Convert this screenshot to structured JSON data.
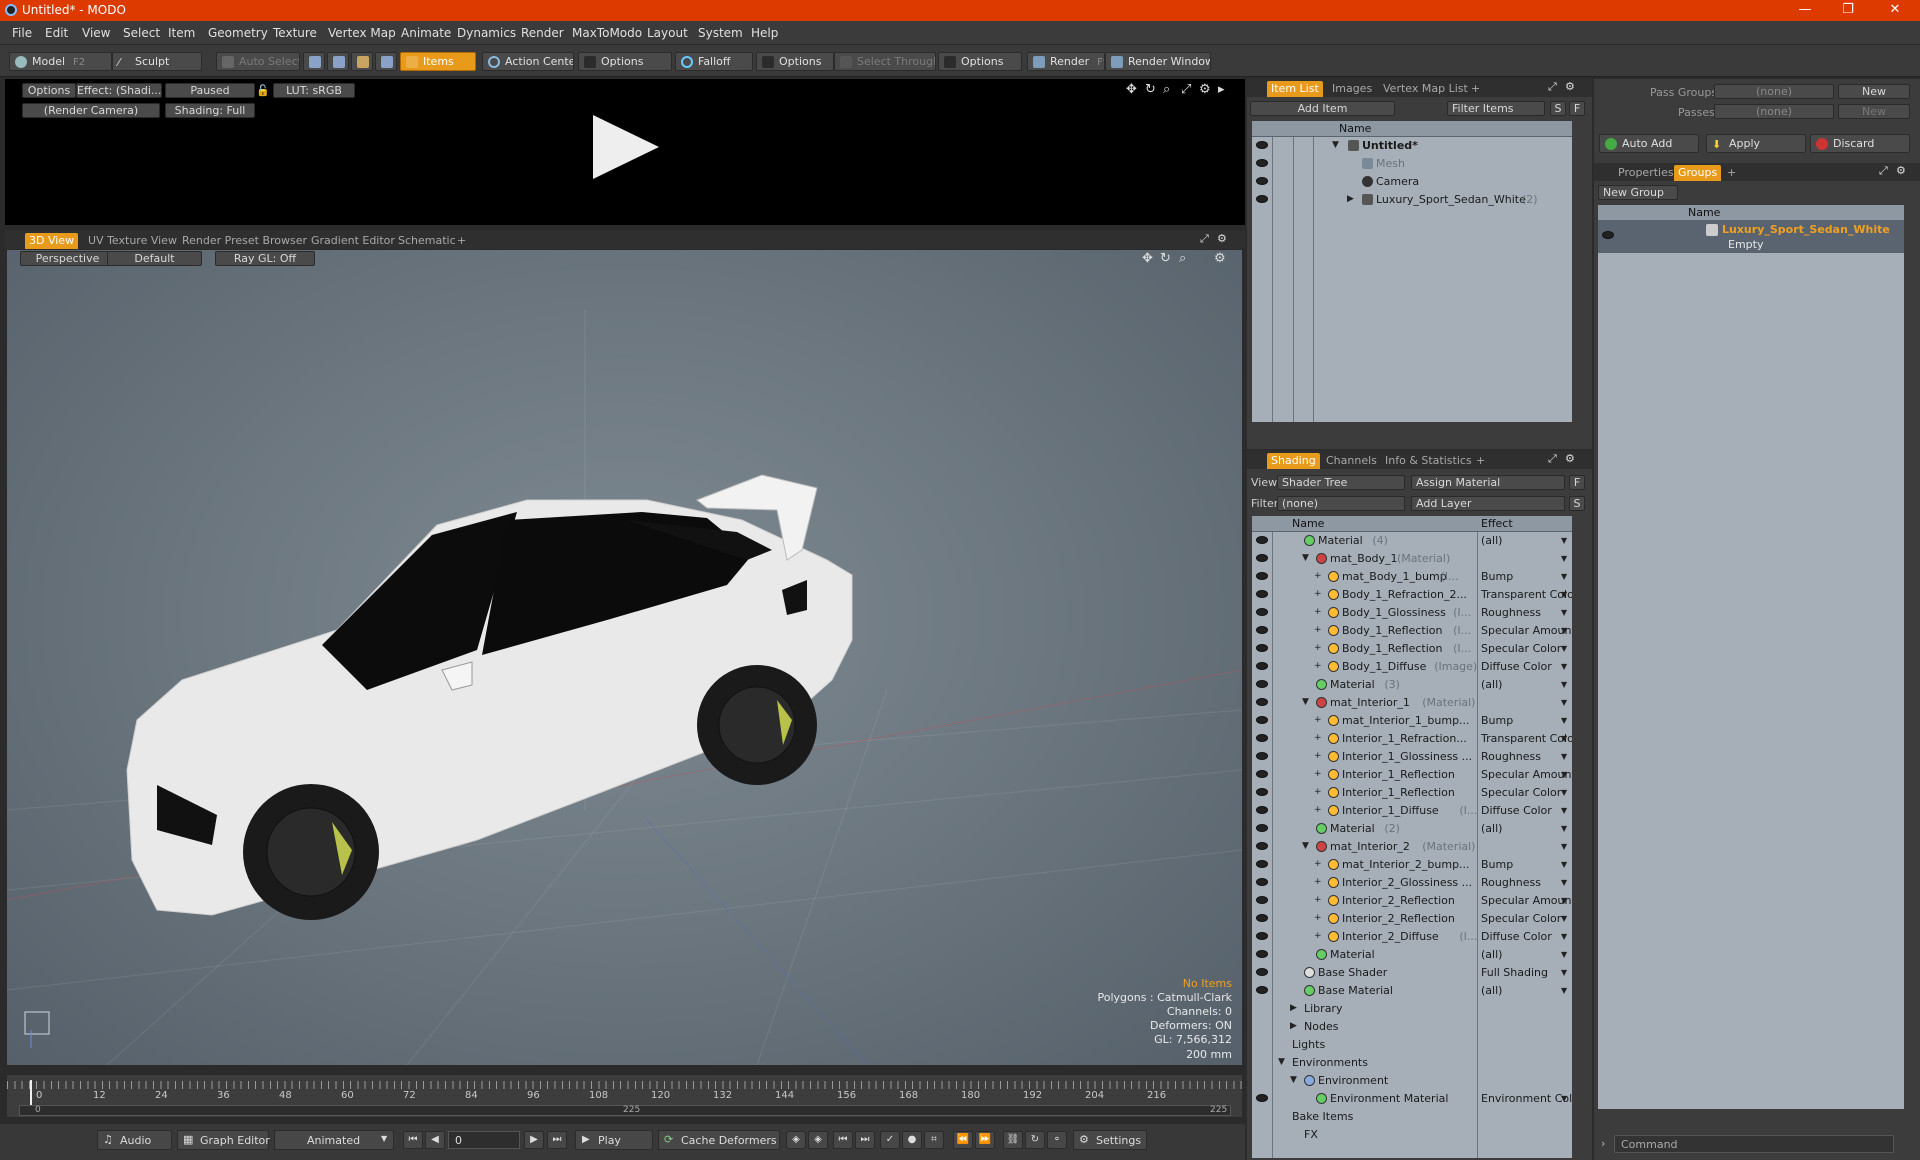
{
  "window": {
    "title": "Untitled* - MODO",
    "minimize": "—",
    "maximize": "❐",
    "close": "✕"
  },
  "menu": [
    "File",
    "Edit",
    "View",
    "Select",
    "Item",
    "Geometry",
    "Texture",
    "Vertex Map",
    "Animate",
    "Dynamics",
    "Render",
    "MaxToModo",
    "Layout",
    "System",
    "Help"
  ],
  "toolbar": {
    "model": "Model",
    "model_key": "F2",
    "sculpt": "Sculpt",
    "auto_select": "Auto Select",
    "items": "Items",
    "action_center": "Action Center",
    "options1": "Options",
    "falloff": "Falloff",
    "options2": "Options",
    "select_through": "Select Through",
    "options3": "Options",
    "render": "Render",
    "render_key": "F9",
    "render_window": "Render Window"
  },
  "preview": {
    "options": "Options",
    "effect": "Effect: (Shadi...",
    "paused": "Paused",
    "lut": "LUT: sRGB",
    "camera": "(Render Camera)",
    "shading": "Shading: Full"
  },
  "view_tabs": [
    "3D View",
    "UV Texture View",
    "Render Preset Browser",
    "Gradient Editor",
    "Schematic",
    "+"
  ],
  "viewport": {
    "perspective": "Perspective",
    "default": "Default",
    "raygl": "Ray GL: Off"
  },
  "hud": {
    "no_items": "No Items",
    "polygons": "Polygons : Catmull-Clark",
    "channels": "Channels: 0",
    "deformers": "Deformers: ON",
    "gl": "GL: 7,566,312",
    "scale": "200 mm"
  },
  "timeline": {
    "ticks": [
      "0",
      "12",
      "24",
      "36",
      "48",
      "60",
      "72",
      "84",
      "96",
      "108",
      "120",
      "132",
      "144",
      "156",
      "168",
      "180",
      "192",
      "204",
      "216"
    ],
    "start": "0",
    "mid": "225",
    "end": "225"
  },
  "bottom": {
    "audio": "Audio",
    "graph_editor": "Graph Editor",
    "animated": "Animated",
    "frame": "0",
    "play": "Play",
    "cache": "Cache Deformers",
    "settings": "Settings"
  },
  "item_list": {
    "tabs": [
      "Item List",
      "Images",
      "Vertex Map List",
      "+"
    ],
    "add_item": "Add Item",
    "filter": "Filter Items",
    "s": "S",
    "f": "F",
    "col_name": "Name",
    "rows": [
      {
        "name": "Untitled*",
        "sub": ""
      },
      {
        "name": "Mesh",
        "sub": ""
      },
      {
        "name": "Camera",
        "sub": ""
      },
      {
        "name": "Luxury_Sport_Sedan_White",
        "sub": "(2)"
      }
    ]
  },
  "shading": {
    "tabs": [
      "Shading",
      "Channels",
      "Info & Statistics",
      "+"
    ],
    "view_label": "View",
    "view_value": "Shader Tree",
    "assign": "Assign Material",
    "f": "F",
    "filter_label": "Filter",
    "filter_value": "(none)",
    "add_layer": "Add Layer",
    "s": "S",
    "col_name": "Name",
    "col_effect": "Effect",
    "rows": [
      {
        "name": "Material",
        "sub": "(4)",
        "effect": "(all)"
      },
      {
        "name": "mat_Body_1",
        "sub": "(Material)",
        "effect": ""
      },
      {
        "name": "mat_Body_1_bump",
        "sub": "(I...",
        "effect": "Bump"
      },
      {
        "name": "Body_1_Refraction_2...",
        "sub": "",
        "effect": "Transparent Color"
      },
      {
        "name": "Body_1_Glossiness",
        "sub": "(I...",
        "effect": "Roughness"
      },
      {
        "name": "Body_1_Reflection",
        "sub": "(I...",
        "effect": "Specular Amount"
      },
      {
        "name": "Body_1_Reflection",
        "sub": "(I...",
        "effect": "Specular Color"
      },
      {
        "name": "Body_1_Diffuse",
        "sub": "(Image)",
        "effect": "Diffuse Color"
      },
      {
        "name": "Material",
        "sub": "(3)",
        "effect": "(all)"
      },
      {
        "name": "mat_Interior_1",
        "sub": "(Material)",
        "effect": ""
      },
      {
        "name": "mat_Interior_1_bump...",
        "sub": "",
        "effect": "Bump"
      },
      {
        "name": "Interior_1_Refraction...",
        "sub": "",
        "effect": "Transparent Color"
      },
      {
        "name": "Interior_1_Glossiness ...",
        "sub": "",
        "effect": "Roughness"
      },
      {
        "name": "Interior_1_Reflection",
        "sub": "",
        "effect": "Specular Amount"
      },
      {
        "name": "Interior_1_Reflection",
        "sub": "",
        "effect": "Specular Color"
      },
      {
        "name": "Interior_1_Diffuse",
        "sub": "(I...",
        "effect": "Diffuse Color"
      },
      {
        "name": "Material",
        "sub": "(2)",
        "effect": "(all)"
      },
      {
        "name": "mat_Interior_2",
        "sub": "(Material)",
        "effect": ""
      },
      {
        "name": "mat_Interior_2_bump...",
        "sub": "",
        "effect": "Bump"
      },
      {
        "name": "Interior_2_Glossiness ...",
        "sub": "",
        "effect": "Roughness"
      },
      {
        "name": "Interior_2_Reflection",
        "sub": "",
        "effect": "Specular Amount"
      },
      {
        "name": "Interior_2_Reflection",
        "sub": "",
        "effect": "Specular Color"
      },
      {
        "name": "Interior_2_Diffuse",
        "sub": "(I...",
        "effect": "Diffuse Color"
      },
      {
        "name": "Material",
        "sub": "",
        "effect": "(all)"
      },
      {
        "name": "Base Shader",
        "sub": "",
        "effect": "Full Shading"
      },
      {
        "name": "Base Material",
        "sub": "",
        "effect": "(all)"
      },
      {
        "name": "Library",
        "sub": "",
        "effect": ""
      },
      {
        "name": "Nodes",
        "sub": "",
        "effect": ""
      },
      {
        "name": "Lights",
        "sub": "",
        "effect": ""
      },
      {
        "name": "Environments",
        "sub": "",
        "effect": ""
      },
      {
        "name": "Environment",
        "sub": "",
        "effect": ""
      },
      {
        "name": "Environment Material",
        "sub": "",
        "effect": "Environment Color"
      },
      {
        "name": "Bake Items",
        "sub": "",
        "effect": ""
      },
      {
        "name": "FX",
        "sub": "",
        "effect": ""
      }
    ]
  },
  "groups": {
    "pass_groups": "Pass Groups",
    "passes": "Passes",
    "none": "(none)",
    "new": "New",
    "auto_add": "Auto Add",
    "apply": "Apply",
    "discard": "Discard",
    "tabs": [
      "Properties",
      "Groups",
      "+"
    ],
    "new_group": "New Group",
    "col_name": "Name",
    "group_name": "Luxury_Sport_Sedan_White",
    "group_sub": "Empty"
  },
  "command": {
    "placeholder": "Command"
  },
  "colors": {
    "accent": "#e89a1a",
    "titlebar": "#dd3a00",
    "tree_bg": "#a6afb8",
    "group_highlight": "#f0a020"
  }
}
